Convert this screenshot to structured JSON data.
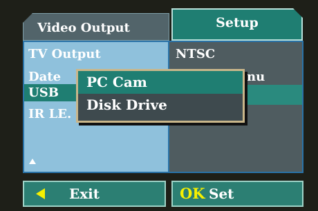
{
  "tabs": {
    "video_output": "Video Output",
    "setup": "Setup"
  },
  "menu": {
    "rows": [
      {
        "label": "TV Output",
        "value": "NTSC"
      },
      {
        "label": "Date",
        "value": "nu"
      },
      {
        "label": "USB",
        "value": ""
      },
      {
        "label": "IR LE.",
        "value": ""
      }
    ]
  },
  "popup": {
    "options": [
      "PC Cam",
      "Disk Drive"
    ],
    "selected": "PC Cam"
  },
  "footer": {
    "exit_label": "Exit",
    "ok_label": "OK",
    "set_label": "Set"
  },
  "icons": {
    "exit": "left-arrow-icon",
    "scroll": "up-triangle-icon"
  },
  "colors": {
    "selected_teal": "#1f7e72",
    "panel_blue": "#8fc1dc",
    "accent_yellow": "#f6f000"
  }
}
